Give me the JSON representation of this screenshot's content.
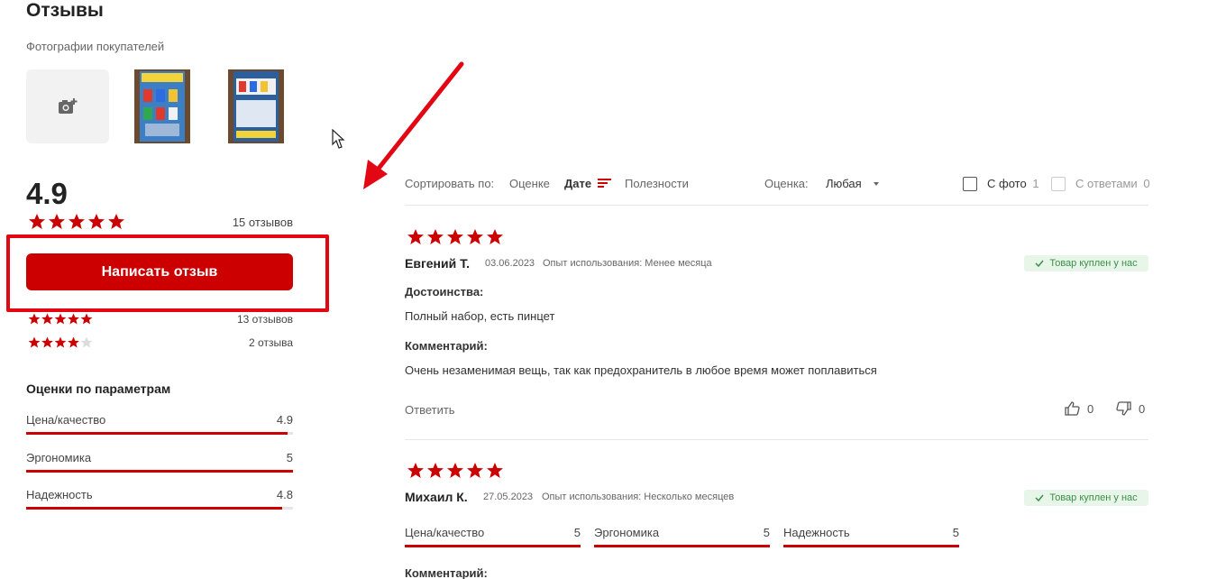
{
  "header": {
    "title": "Отзывы",
    "photos_label": "Фотографии покупателей"
  },
  "summary": {
    "rating": "4.9",
    "stars": 5,
    "reviews_count": "15 отзывов",
    "write_button": "Написать отзыв",
    "distribution": [
      {
        "stars": 5,
        "count": "13 отзывов"
      },
      {
        "stars": 4,
        "count": "2 отзыва"
      }
    ]
  },
  "params": {
    "title": "Оценки по параметрам",
    "items": [
      {
        "label": "Цена/качество",
        "value": "4.9",
        "fraction": 0.98
      },
      {
        "label": "Эргономика",
        "value": "5",
        "fraction": 1.0
      },
      {
        "label": "Надежность",
        "value": "4.8",
        "fraction": 0.96
      }
    ]
  },
  "sort": {
    "label": "Сортировать по:",
    "options": [
      "Оценке",
      "Дате",
      "Полезности"
    ],
    "active": "Дате",
    "rating_label": "Оценка:",
    "rating_value": "Любая",
    "with_photo": "С фото",
    "with_photo_count": "1",
    "with_answers": "С ответами",
    "with_answers_count": "0"
  },
  "reviews": [
    {
      "stars": 5,
      "author": "Евгений Т.",
      "date": "03.06.2023",
      "experience": "Опыт использования: Менее месяца",
      "badge": "Товар куплен у нас",
      "pros_label": "Достоинства:",
      "pros": "Полный набор, есть пинцет",
      "comment_label": "Комментарий:",
      "comment": "Очень незаменимая вещь, так как предохранитель в любое время может поплавиться",
      "reply": "Ответить",
      "likes": "0",
      "dislikes": "0"
    },
    {
      "stars": 5,
      "author": "Михаил К.",
      "date": "27.05.2023",
      "experience": "Опыт использования: Несколько месяцев",
      "badge": "Товар куплен у нас",
      "params": [
        {
          "label": "Цена/качество",
          "value": "5"
        },
        {
          "label": "Эргономика",
          "value": "5"
        },
        {
          "label": "Надежность",
          "value": "5"
        }
      ],
      "comment_label": "Комментарий:"
    }
  ],
  "colors": {
    "accent": "#cc0000",
    "annotation": "#e30613",
    "bought_bg": "#e8f6ea",
    "bought_text": "#3a8f47"
  },
  "icons": [
    "camera-add-icon",
    "star-icon",
    "sort-icon",
    "caret-down-icon",
    "check-icon",
    "thumb-up-icon",
    "thumb-down-icon",
    "cursor-icon"
  ]
}
